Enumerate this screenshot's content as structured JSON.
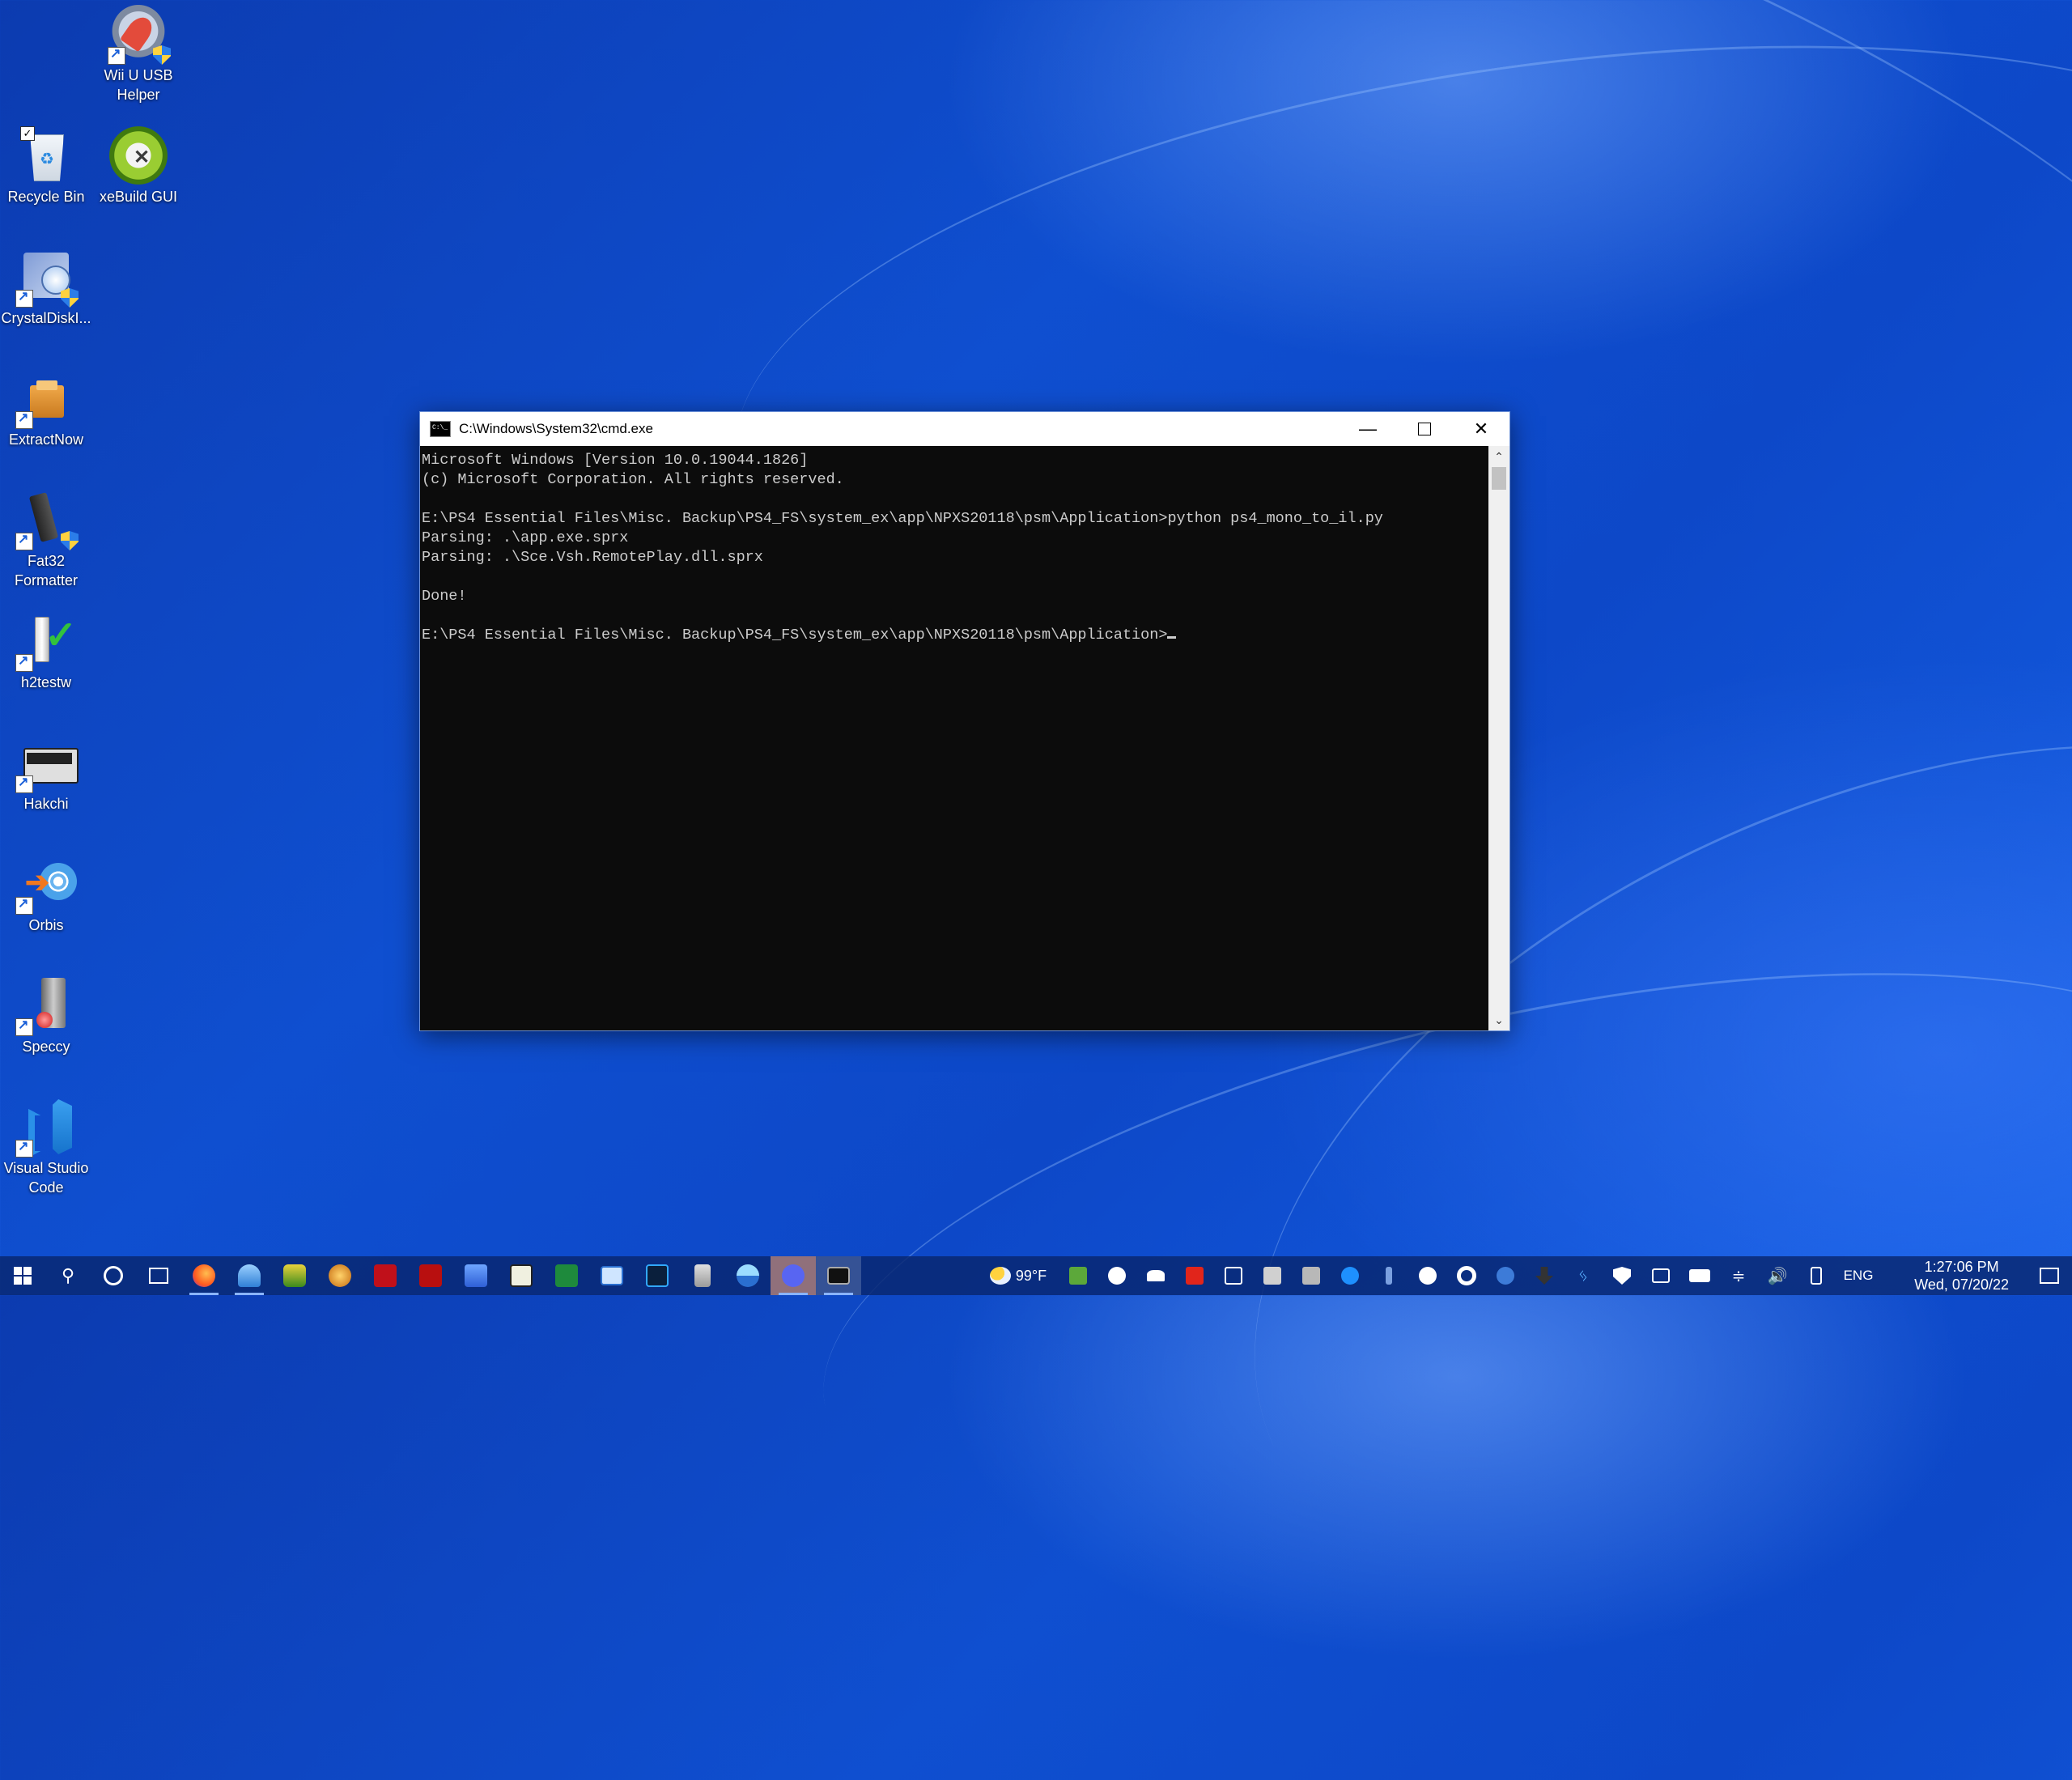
{
  "desktop": {
    "icons": [
      {
        "label": "Wii U USB Helper"
      },
      {
        "label": "Recycle Bin"
      },
      {
        "label": "xeBuild GUI"
      },
      {
        "label": "CrystalDiskI..."
      },
      {
        "label": "ExtractNow"
      },
      {
        "label": "Fat32 Formatter"
      },
      {
        "label": "h2testw"
      },
      {
        "label": "Hakchi"
      },
      {
        "label": "Orbis"
      },
      {
        "label": "Speccy"
      },
      {
        "label": "Visual Studio Code"
      }
    ]
  },
  "window": {
    "title": "C:\\Windows\\System32\\cmd.exe",
    "lines": [
      "Microsoft Windows [Version 10.0.19044.1826]",
      "(c) Microsoft Corporation. All rights reserved.",
      "",
      "E:\\PS4 Essential Files\\Misc. Backup\\PS4_FS\\system_ex\\app\\NPXS20118\\psm\\Application>python ps4_mono_to_il.py",
      "Parsing: .\\app.exe.sprx",
      "Parsing: .\\Sce.Vsh.RemotePlay.dll.sprx",
      "",
      "Done!",
      "",
      "E:\\PS4 Essential Files\\Misc. Backup\\PS4_FS\\system_ex\\app\\NPXS20118\\psm\\Application>"
    ]
  },
  "taskbar": {
    "weather": "99°F",
    "language": "ENG",
    "time": "1:27:06 PM",
    "date": "Wed, 07/20/22"
  }
}
